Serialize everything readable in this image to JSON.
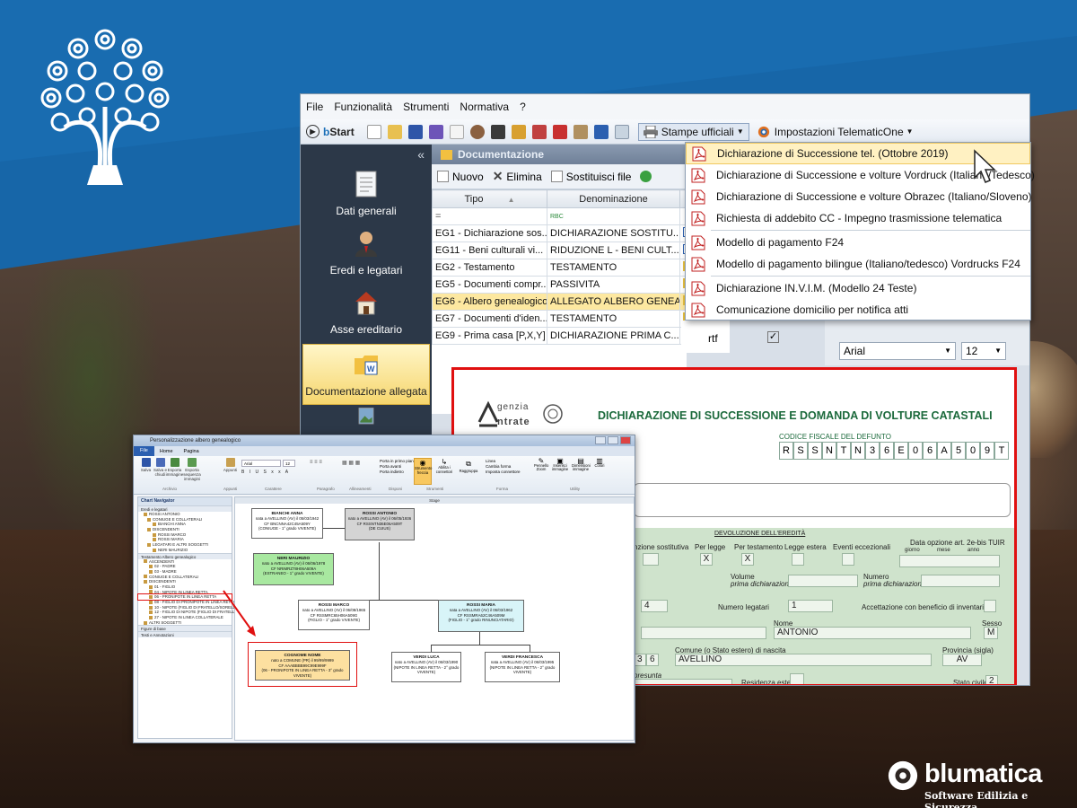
{
  "app": {
    "menu": [
      "File",
      "Funzionalità",
      "Strumenti",
      "Normativa",
      "?"
    ],
    "toolbar": {
      "bstart_prefix": "b",
      "bstart_rest": "Start",
      "stampe_ufficiali": "Stampe ufficiali",
      "impostazioni": "Impostazioni TelematicOne"
    },
    "sidebar": {
      "collapse_icon": "«",
      "items": [
        {
          "label": "Dati generali",
          "icon": "document-icon"
        },
        {
          "label": "Eredi e legatari",
          "icon": "person-icon"
        },
        {
          "label": "Asse ereditario",
          "icon": "house-icon"
        },
        {
          "label": "Documentazione allegata",
          "icon": "folder-word-icon"
        }
      ]
    },
    "documentazione": {
      "header": "Documentazione",
      "toolbar": {
        "nuovo": "Nuovo",
        "elimina": "Elimina",
        "sostituisci": "Sostituisci file"
      },
      "columns": {
        "tipo": "Tipo",
        "denominazione": "Denominazione"
      },
      "filter": {
        "tipo": "=",
        "denominazione": "RBC"
      },
      "rows": [
        {
          "tipo": "EG1 - Dichiarazione sos...",
          "denominazione": "DICHIARAZIONE SOSTITU..."
        },
        {
          "tipo": "EG11 - Beni culturali vi...",
          "denominazione": "RIDUZIONE L - BENI CULT..."
        },
        {
          "tipo": "EG2 - Testamento",
          "denominazione": "TESTAMENTO"
        },
        {
          "tipo": "EG5 - Documenti compr...",
          "denominazione": "PASSIVITA"
        },
        {
          "tipo": "EG6 - Albero genealogico",
          "denominazione": "ALLEGATO ALBERO GENEA...",
          "highlight": true
        },
        {
          "tipo": "EG7 - Documenti d'iden...",
          "denominazione": "TESTAMENTO"
        },
        {
          "tipo": "EG9 - Prima casa [P,X,Y]",
          "denominazione": "DICHIARAZIONE PRIMA C..."
        }
      ],
      "rtf_label": "rtf"
    },
    "font": {
      "name": "Arial",
      "size": "12"
    },
    "stampe_menu": [
      "Dichiarazione di Successione tel. (Ottobre 2019)",
      "Dichiarazione di Successione  e volture Vordruck (Italiano/Tedesco)",
      "Dichiarazione di Successione  e volture  Obrazec  (Italiano/Sloveno)",
      "Richiesta di addebito CC - Impegno trasmissione telematica",
      "Modello di pagamento F24",
      "Modello di pagamento bilingue (Italiano/tedesco) Vordrucks F24",
      "Dichiarazione IN.V.I.M. (Modello 24 Teste)",
      "Comunicazione domicilio per notifica atti"
    ],
    "preview": {
      "agenzia_line1": "genzia",
      "agenzia_line2": "ntrate",
      "title": "DICHIARAZIONE DI SUCCESSIONE E DOMANDA DI VOLTURE CATASTALI",
      "cf_label": "CODICE FISCALE DEL DEFUNTO",
      "cf": [
        "R",
        "S",
        "S",
        "N",
        "T",
        "N",
        "3",
        "6",
        "E",
        "0",
        "6",
        "A",
        "5",
        "0",
        "9",
        "T"
      ],
      "devoluzione": "DEVOLUZIONE DELL'EREDITÀ",
      "f_dich_sost": "nzione sostitutiva",
      "f_per_legge": "Per legge",
      "f_per_test": "Per testamento",
      "f_legge_estera": "Legge estera",
      "f_eventi": "Eventi eccezionali",
      "f_data_opzione": "Data opzione art. 2e-bis TUIR",
      "f_giorno": "giorno",
      "f_mese": "mese",
      "f_anno": "anno",
      "mark_x": "X",
      "f_volume": "Volume",
      "f_prima_dich": "prima dichiarazione",
      "f_numero": "Numero",
      "f_numero_legatari": "Numero legatari",
      "v_num4": "4",
      "v_num1": "1",
      "f_accettazione": "Accettazione con beneficio di inventario",
      "f_nome": "Nome",
      "v_nome": "ANTONIO",
      "f_sesso": "Sesso",
      "v_sesso": "M",
      "f_comune": "Comune (o Stato estero) di nascita",
      "v_comune": "AVELLINO",
      "v_3": "3",
      "v_6": "6",
      "f_provincia": "Provincia (sigla)",
      "v_provincia": "AV",
      "f_presunta": "presunta",
      "f_residenza": "Residenza estera",
      "f_stato_civile": "Stato civile",
      "v_stato": "2"
    }
  },
  "win2": {
    "title": "Personalizzazione albero genealogico",
    "tabs": [
      "File",
      "Home",
      "Pagina"
    ],
    "ribbon": {
      "buttons_archivio": [
        "Salva",
        "Salva e chiudi",
        "Esporta immagine",
        "Esporta sequenza immagini"
      ],
      "appunti": "Appunti",
      "font_name": "Arial",
      "font_size": "12",
      "labels": [
        "Archivio",
        "Carattere",
        "Paragrafo",
        "Allineamenti",
        "Disponi",
        "Strumenti",
        "Forma",
        "Utility"
      ],
      "small": [
        "Porta in primo piano",
        "Porta avanti",
        "Porta indietro",
        "Strumento freccia",
        "Abilita i connettori",
        "Raggruppa",
        "Linea",
        "Cambia forma",
        "Imposta connettore",
        "Pennello Zoom",
        "Inserisci immagine",
        "Dimensioni immagine",
        "Colori"
      ],
      "sections": [
        "Archivio",
        "Appunti",
        "Carattere",
        "Paragrafo",
        "Allineamenti",
        "Disponi",
        "Strumenti",
        "Forma",
        "Utility"
      ]
    },
    "nav": {
      "title": "Chart Navigator",
      "sections": [
        "Eredi e legatari",
        "Testamento Albero genealogico",
        "Figure di base",
        "Testi e Annotazioni"
      ],
      "tree1": [
        "ROSSI ANTONIO",
        "CONIUGE E COLLATERALI",
        "BIANCHI ANNA",
        "DISCENDENTI",
        "ROSSI MARCO",
        "ROSSI MARIA",
        "LEGATARI E ALTRI SOGGETTI",
        "NERI MAURIZIO"
      ],
      "tree2": [
        "ASCENDENTI",
        "02 - PADRE",
        "03 - MADRE",
        "CONIUGE E COLLATERALI",
        "DISCENDENTI",
        "01 - FIGLIO",
        "04 - NIPOTE IN LINEA RETTA",
        "06 - PRONIPOTE IN LINEA RETTA",
        "08 - FIGLIO DI PRONIPOTE IN LINEA RETTA",
        "10 - NIPOTE (FIGLIO DI FRATELLO/SORELLA)",
        "12 - FIGLIO DI NIPOTE (FIGLIO DI FRATELLO)",
        "27 - NIPOTE IN LINEA COLLATERALE",
        "ALTRI SOGGETTI"
      ]
    },
    "stage": {
      "title": "Stage",
      "boxes": {
        "bianchi": {
          "name": "BIANCHI ANNA",
          "l1": "nata a AVELLINO (AV) il 05/03/1942",
          "l2": "CF BNCNNA42C45A509Y",
          "l3": "(CONIUGE - 1° grado  VIVENTE)"
        },
        "rossi_a": {
          "name": "ROSSI ANTONIO",
          "l1": "nato a AVELLINO (AV) il 06/05/1936",
          "l2": "CF RSSNTN36E06A509T",
          "l3": "(DE CUIUS)"
        },
        "neri": {
          "name": "NERI MAURIZIO",
          "l1": "nato a AVELLINO (AV) il 06/06/1978",
          "l2": "CF NRIMRZ78H06A509A",
          "l3": "(ESTRANEO - 1° grado  VIVENTE)"
        },
        "rossi_m": {
          "name": "ROSSI MARCO",
          "l1": "nato a AVELLINO (AV) il 06/08/1965",
          "l2": "CF RSSMRC65H06A509G",
          "l3": "(FIGLIO - 1° grado  VIVENTE)"
        },
        "rossi_ma": {
          "name": "ROSSI MARIA",
          "l1": "nata a AVELLINO (AV) il 06/03/1962",
          "l2": "CF RSSMRA62C46A509M",
          "l3": "(FIGLIO - 1° grado  RINUNCIATARIO)"
        },
        "cognome": {
          "name": "COGNOME NOME",
          "l1": "nato a COMUNE (PR) il 99/99/9999",
          "l2": "CF AAABBBB99C99E999F",
          "l3": "(06 - PRONIPOTE IN LINEA RETTA - 3° grado  VIVENTE)"
        },
        "verdi_l": {
          "name": "VERDI LUCA",
          "l1": "nato a AVELLINO (AV) il 06/03/1990",
          "l2": "(NIPOTE IN LINEA RETTA - 2° grado",
          "l3": "VIVENTE)"
        },
        "verdi_f": {
          "name": "VERDI FRANCESCA",
          "l1": "nata a AVELLINO (AV) il 06/03/1995",
          "l2": "(NIPOTE IN LINEA RETTA - 2° grado",
          "l3": "VIVENTE)"
        }
      }
    }
  },
  "brand": {
    "name": "blumatica",
    "tagline": "Software Edilizia e Sicurezza",
    "blue": "#1766a8"
  }
}
